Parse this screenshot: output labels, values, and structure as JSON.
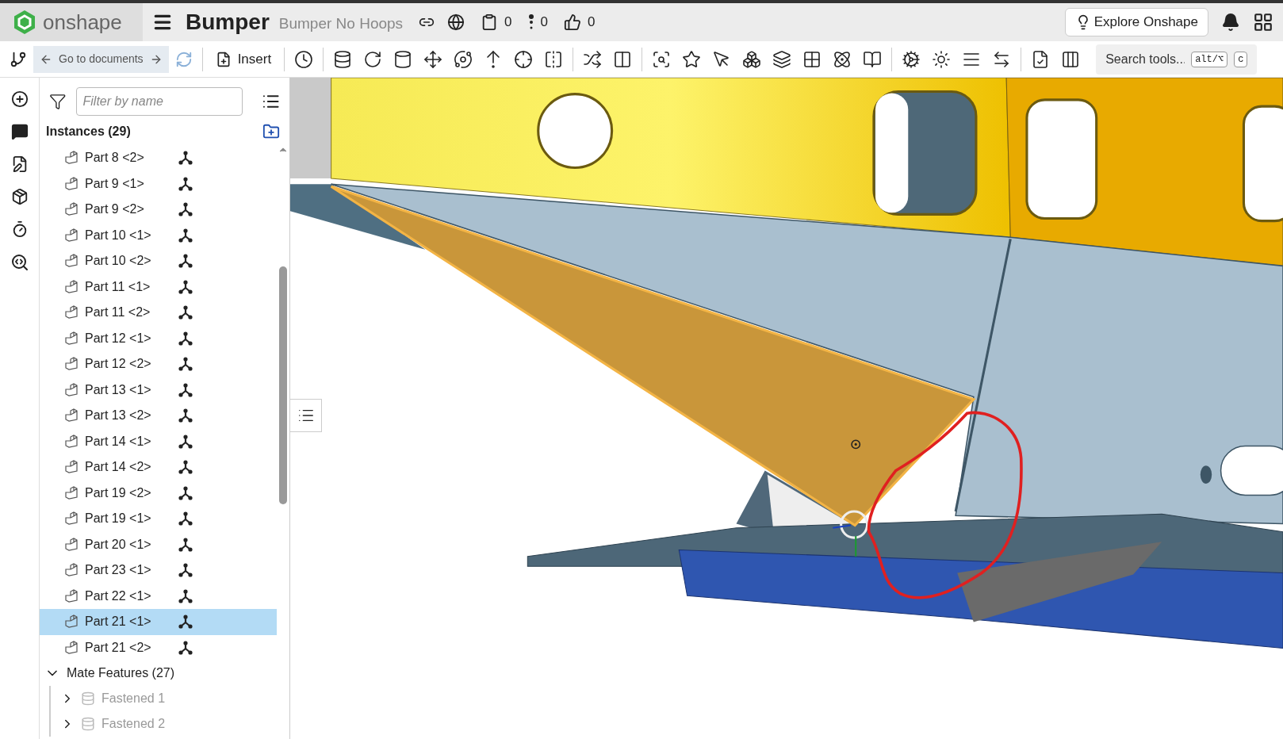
{
  "header": {
    "logo_text": "onshape",
    "document_title": "Bumper",
    "workspace": "Bumper No Hoops",
    "counters": [
      "0",
      "0",
      "0"
    ],
    "explore_button": "Explore Onshape"
  },
  "toolbar": {
    "tooltip": "Go to documents",
    "insert_button": "Insert",
    "search_placeholder": "Search tools...",
    "shortcut_keys": [
      "alt/⌥",
      "c"
    ]
  },
  "panel": {
    "filter_placeholder": "Filter by name",
    "instances_title": "Instances (29)",
    "instances": [
      {
        "label": "Part 8 <2>",
        "selected": false
      },
      {
        "label": "Part 9 <1>",
        "selected": false
      },
      {
        "label": "Part 9 <2>",
        "selected": false
      },
      {
        "label": "Part 10 <1>",
        "selected": false
      },
      {
        "label": "Part 10 <2>",
        "selected": false
      },
      {
        "label": "Part 11 <1>",
        "selected": false
      },
      {
        "label": "Part 11 <2>",
        "selected": false
      },
      {
        "label": "Part 12 <1>",
        "selected": false
      },
      {
        "label": "Part 12 <2>",
        "selected": false
      },
      {
        "label": "Part 13 <1>",
        "selected": false
      },
      {
        "label": "Part 13 <2>",
        "selected": false
      },
      {
        "label": "Part 14 <1>",
        "selected": false
      },
      {
        "label": "Part 14 <2>",
        "selected": false
      },
      {
        "label": "Part 19 <2>",
        "selected": false
      },
      {
        "label": "Part 19 <1>",
        "selected": false
      },
      {
        "label": "Part 20 <1>",
        "selected": false
      },
      {
        "label": "Part 23 <1>",
        "selected": false
      },
      {
        "label": "Part 22 <1>",
        "selected": false
      },
      {
        "label": "Part 21 <1>",
        "selected": true
      },
      {
        "label": "Part 21 <2>",
        "selected": false
      }
    ],
    "mate_features": {
      "label": "Mate Features (27)",
      "expanded": true,
      "children": [
        {
          "label": "Fastened 1",
          "expanded": false
        },
        {
          "label": "Fastened 2",
          "expanded": false
        }
      ]
    }
  }
}
